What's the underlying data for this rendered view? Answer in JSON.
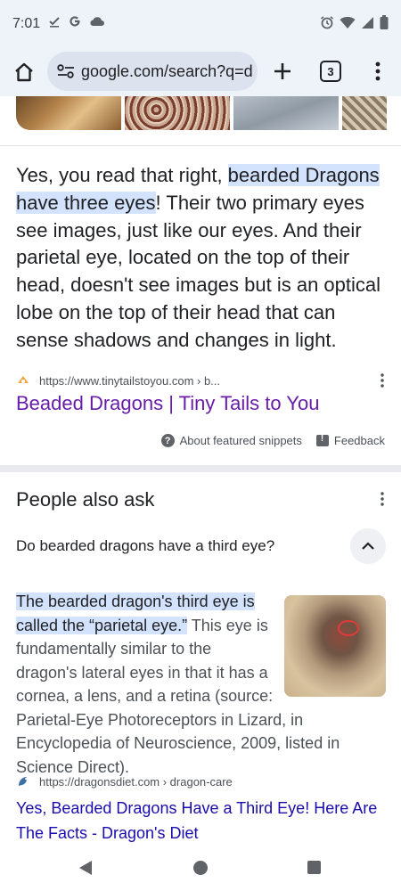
{
  "status_bar": {
    "time": "7:01",
    "left_icons": [
      "download-done-icon",
      "google-g-icon",
      "cloud-icon"
    ],
    "right_icons": [
      "alarm-icon",
      "wifi-icon",
      "signal-icon",
      "battery-icon"
    ]
  },
  "toolbar": {
    "url": "google.com/search?q=d",
    "tab_count": "3"
  },
  "snippet": {
    "text_pre": "Yes, you read that right, ",
    "text_highlight": "bearded Dragons have three eyes",
    "text_post": "! Their two primary eyes see images, just like our eyes. And their parietal eye, located on the top of their head, doesn't see images but is an optical lobe on the top of their head that can sense shadows and changes in light.",
    "source_url": "https://www.tinytailstoyou.com › b...",
    "link_title": "Beaded Dragons | Tiny Tails to You",
    "about_label": "About featured snippets",
    "feedback_label": "Feedback"
  },
  "paa": {
    "title": "People also ask",
    "question": "Do bearded dragons have a third eye?",
    "answer_highlight": "The bearded dragon's third eye is called the “parietal eye.”",
    "answer_rest": " This eye is fundamentally similar to the dragon's lateral eyes in that it has a cornea, a lens, and a retina (source: Parietal-Eye Photoreceptors in Lizard, in Encyclopedia of Neuroscience, 2009, listed in Science Direct).",
    "source_url": "https://dragonsdiet.com › dragon-care",
    "link_title": "Yes, Bearded Dragons Have a Third Eye! Here Are The Facts - Dragon's Diet"
  },
  "colors": {
    "highlight": "#d3e3fd",
    "visited_link": "#681da8",
    "link": "#1a0dab",
    "toolbar_bg": "#eef2f9"
  }
}
